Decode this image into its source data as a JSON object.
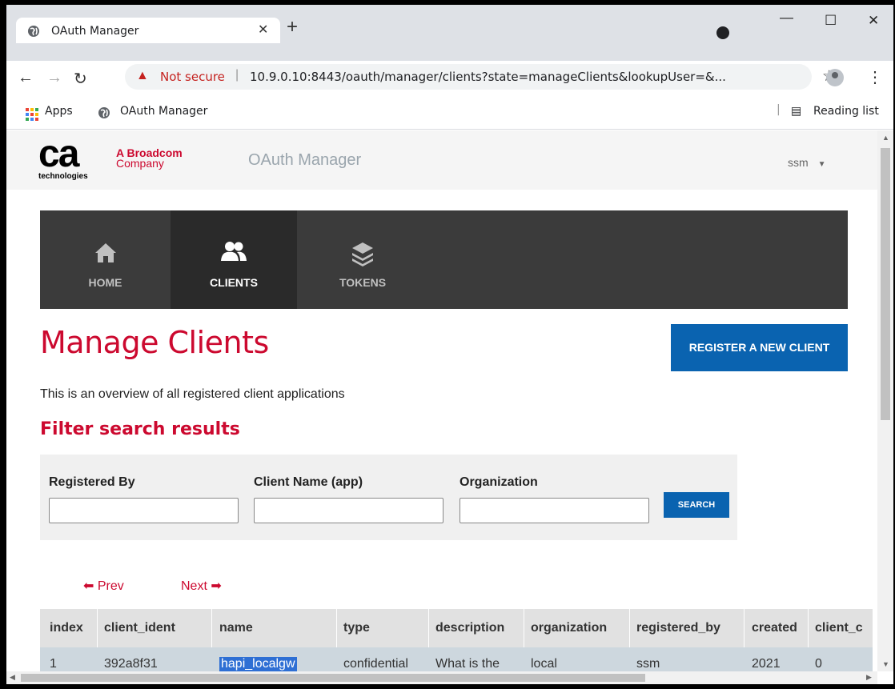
{
  "browser": {
    "tab_title": "OAuth Manager",
    "not_secure": "Not secure",
    "url": "10.9.0.10:8443/oauth/manager/clients?state=manageClients&lookupUser=&...",
    "bookmarks": [
      "Apps",
      "OAuth Manager"
    ],
    "reading_list": "Reading list"
  },
  "header": {
    "logo_ca": "ca",
    "logo_tech": "technologies",
    "broadcom_line1": "A Broadcom",
    "broadcom_line2": "Company",
    "app_title": "OAuth Manager",
    "user": "ssm"
  },
  "nav": {
    "items": [
      {
        "label": "HOME",
        "icon": "home-icon"
      },
      {
        "label": "CLIENTS",
        "icon": "users-icon"
      },
      {
        "label": "TOKENS",
        "icon": "layers-icon"
      }
    ]
  },
  "main": {
    "title": "Manage Clients",
    "register_label": "REGISTER A NEW CLIENT",
    "overview": "This is an overview of all registered client applications",
    "filter_title": "Filter search results"
  },
  "filter": {
    "registered_by_label": "Registered By",
    "client_name_label": "Client Name (app)",
    "organization_label": "Organization",
    "registered_by_value": "",
    "client_name_value": "",
    "organization_value": "",
    "search_label": "SEARCH"
  },
  "pager": {
    "prev": "Prev",
    "next": "Next"
  },
  "table": {
    "headers": [
      "index",
      "client_ident",
      "name",
      "type",
      "description",
      "organization",
      "registered_by",
      "created",
      "client_c"
    ],
    "rows": [
      [
        "1",
        "392a8f31",
        "hapi_localgw",
        "confidential",
        "What is the",
        "local",
        "ssm",
        "2021",
        "0"
      ]
    ]
  },
  "colors": {
    "accent_red": "#cc092f",
    "primary_blue": "#0a63b0",
    "nav_bg": "#3b3b3b"
  }
}
